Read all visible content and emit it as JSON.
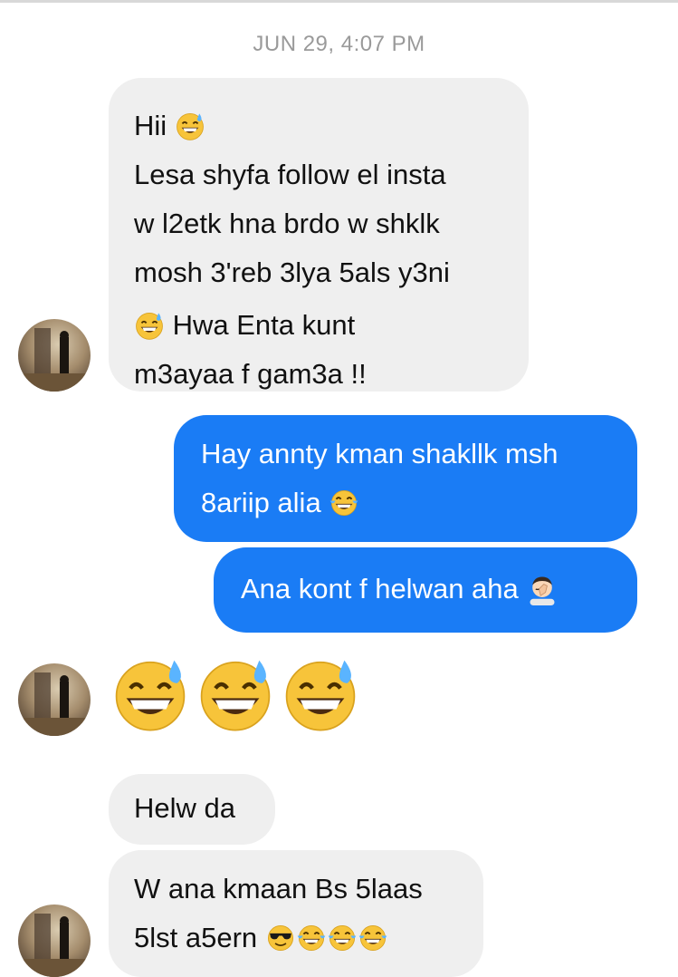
{
  "conversation": {
    "timestamp": "JUN 29, 4:07 PM",
    "messages": [
      {
        "sender": "them",
        "lines": [
          "Hii",
          "Lesa shyfa follow el insta",
          "w l2etk hna brdo w shklk",
          "mosh 3'reb 3lya 5als y3ni",
          "Hwa Enta kunt",
          "m3ayaa f gam3a !!"
        ],
        "emojis": [
          "grinning-sweat-emoji",
          "grinning-sweat-emoji"
        ]
      },
      {
        "sender": "me",
        "lines": [
          "Hay annty kman shakllk msh",
          "8ariip alia"
        ],
        "emojis": [
          "tears-of-joy-emoji"
        ]
      },
      {
        "sender": "me",
        "lines": [
          "Ana kont f helwan aha"
        ],
        "emojis": [
          "facepalm-man-emoji"
        ]
      },
      {
        "sender": "them",
        "lines": [],
        "emojis": [
          "grinning-sweat-emoji",
          "grinning-sweat-emoji",
          "grinning-sweat-emoji"
        ]
      },
      {
        "sender": "them",
        "lines": [
          "Helw da"
        ],
        "emojis": []
      },
      {
        "sender": "them",
        "lines": [
          "W ana kmaan Bs 5laas",
          "5lst a5ern"
        ],
        "emojis": [
          "sunglasses-emoji",
          "tears-of-joy-emoji",
          "tears-of-joy-emoji",
          "tears-of-joy-emoji"
        ]
      }
    ]
  },
  "colors": {
    "incoming_bubble": "#efefef",
    "outgoing_bubble": "#1a7cf5",
    "timestamp_text": "#9a9a9a"
  }
}
